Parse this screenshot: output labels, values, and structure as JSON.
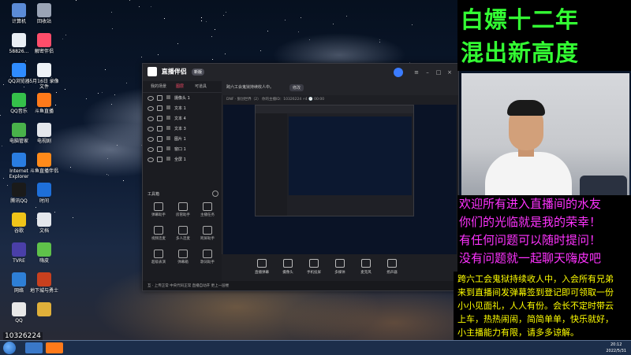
{
  "desktop": {
    "icons": [
      {
        "label": "计算机",
        "color": "#5b8bd6"
      },
      {
        "label": "回收站",
        "color": "#9aa4b5"
      },
      {
        "label": "58826…",
        "color": "#e9eef5"
      },
      {
        "label": "解密伴侣",
        "color": "#ff4d6a"
      },
      {
        "label": "QQ浏览器",
        "color": "#2f8cff"
      },
      {
        "label": "5月16日 录像文件",
        "color": "#eef2f7"
      },
      {
        "label": "QQ音乐",
        "color": "#35c04a"
      },
      {
        "label": "斗鱼直播",
        "color": "#ff7a1a"
      },
      {
        "label": "电脑管家",
        "color": "#49b24a"
      },
      {
        "label": "电视剧",
        "color": "#e4e7ec"
      },
      {
        "label": "Internet Explorer",
        "color": "#2a7de1"
      },
      {
        "label": "斗鱼直播伴侣",
        "color": "#ff8a1a"
      },
      {
        "label": "腾讯QQ",
        "color": "#1a1a1a"
      },
      {
        "label": "时间",
        "color": "#1e6fd9"
      },
      {
        "label": "谷歌",
        "color": "#f0c419"
      },
      {
        "label": "文档",
        "color": "#e4e7ec"
      },
      {
        "label": "TVRE",
        "color": "#4a3fa8"
      },
      {
        "label": "嗨皮",
        "color": "#5fc14a"
      },
      {
        "label": "网络",
        "color": "#2e7fd6"
      },
      {
        "label": "地下城与勇士",
        "color": "#c8401e"
      },
      {
        "label": "QQ",
        "color": "#e8e8e8"
      },
      {
        "label": "",
        "color": "#e0b03a"
      }
    ],
    "room_id": "10326224"
  },
  "app": {
    "logo": "直播伴侣",
    "badge": "新版",
    "left_tabs": [
      "我的场景",
      "图层",
      "可道具"
    ],
    "layers": [
      "摄像头 1",
      "文本 1",
      "文本 4",
      "文本 3",
      "图片 1",
      "窗口 1",
      "全屏 1"
    ],
    "tools_title": "工具箱",
    "tools": [
      {
        "label": "弹幕助手"
      },
      {
        "label": "房管助手"
      },
      {
        "label": "主播任务"
      },
      {
        "label": "视频连麦"
      },
      {
        "label": "多人连麦"
      },
      {
        "label": "跨屏助手"
      },
      {
        "label": "超级表演"
      },
      {
        "label": "弹幕箱"
      },
      {
        "label": "歌词助手"
      }
    ],
    "top_title": "跨六工会鬼狱持续收人中。",
    "top_pill": "修改",
    "sub_bar": "DNF · 狠创世界（2）  你的主播ID：10326224    ⚡4   🕐 00:00",
    "bottom_items": [
      "直播弹幕",
      "摄像头",
      "手机投屏",
      "多媒体",
      "麦克风",
      "扬声器"
    ],
    "status": "互 · 上传正常  中央代码正常  直播自动开  更上一层楼"
  },
  "overlay": {
    "title_lines": [
      "白嫖十二年",
      "混出新高度"
    ],
    "scroll_lines": [
      "欢迎所有进入直播间的水友",
      "你们的光临就是我的荣幸！",
      "有任何问题可以随时提问！",
      "没有问题就一起聊天嗨皮吧"
    ],
    "notice_lines": [
      "跨六工会鬼狱持续收人中，入会所有兄弟",
      "来到直播间发弹幕签到登记即可领取一份",
      "小小见面礼，人人有份。会长不定时带云",
      "上车，热热闹闹，简简单单，快乐就好，",
      "小主播能力有限，请多多谅解。"
    ],
    "title_color": "#33ff33",
    "scroll_color": "#ff33ff",
    "notice_color": "#ffff00"
  },
  "taskbar": {
    "clock_time": "20:12",
    "clock_date": "2022/5/31"
  }
}
